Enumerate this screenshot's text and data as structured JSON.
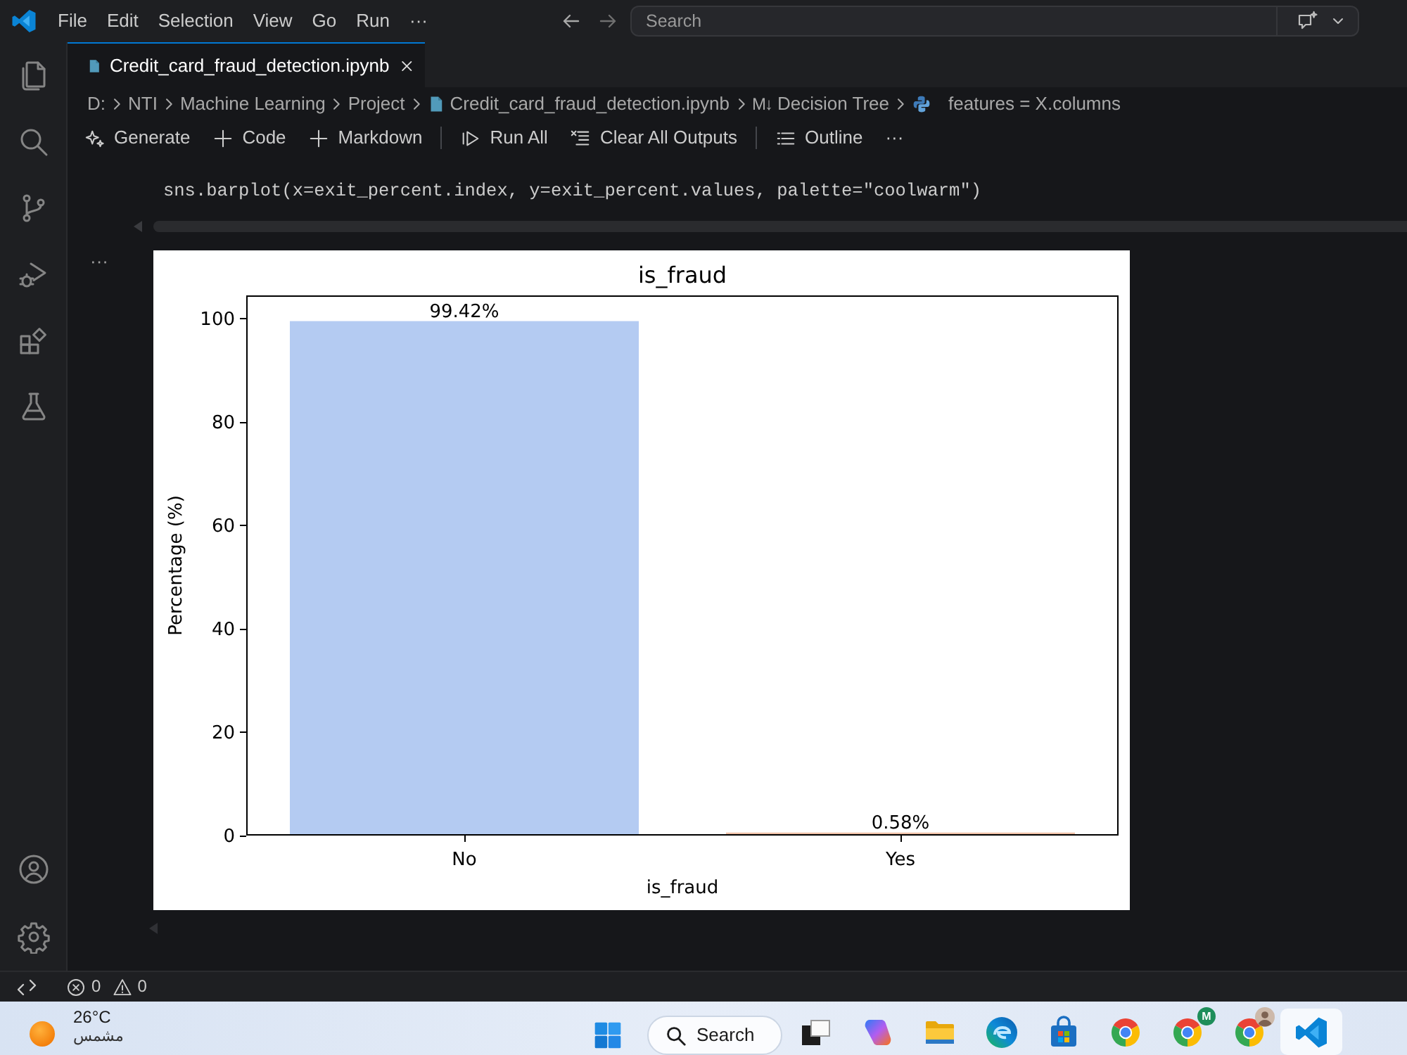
{
  "title_bar": {
    "menu": [
      "File",
      "Edit",
      "Selection",
      "View",
      "Go",
      "Run"
    ],
    "more": "···",
    "search": {
      "placeholder": "Search"
    }
  },
  "tabs": [
    {
      "label": "Credit_card_fraud_detection.ipynb",
      "selected": true
    }
  ],
  "breadcrumb": [
    {
      "kind": "folder",
      "label": "D:"
    },
    {
      "kind": "folder",
      "label": "NTI"
    },
    {
      "kind": "folder",
      "label": "Machine Learning"
    },
    {
      "kind": "folder",
      "label": "Project"
    },
    {
      "kind": "notebook",
      "label": "Credit_card_fraud_detection.ipynb"
    },
    {
      "kind": "markdown",
      "icon": "M↓",
      "label": "Decision Tree"
    },
    {
      "kind": "python",
      "label": "features = X.columns"
    }
  ],
  "toolbar": {
    "groups": [
      [
        {
          "kind": "generate",
          "label": "Generate"
        },
        {
          "kind": "add",
          "label": "Code"
        },
        {
          "kind": "add",
          "label": "Markdown"
        }
      ],
      [
        {
          "kind": "run",
          "label": "Run All"
        },
        {
          "kind": "clear",
          "label": "Clear All Outputs"
        }
      ],
      [
        {
          "kind": "outline",
          "label": "Outline"
        }
      ]
    ],
    "more": "···"
  },
  "cell": {
    "code": "sns.barplot(x=exit_percent.index, y=exit_percent.values, palette=\"coolwarm\")",
    "output_menu": "···",
    "chart_data": {
      "type": "bar",
      "title": "is_fraud",
      "xlabel": "is_fraud",
      "ylabel": "Percentage (%)",
      "categories": [
        "No",
        "Yes"
      ],
      "values": [
        99.42,
        0.58
      ],
      "colors": [
        "#b4cbf2",
        "#eebfa5"
      ],
      "ylim": [
        0,
        104.39
      ],
      "yticks": [
        0,
        20,
        40,
        60,
        80,
        100
      ],
      "value_labels": [
        "99.42%",
        "0.58%"
      ]
    }
  },
  "status_bar": {
    "errors": "0",
    "warnings": "0"
  },
  "taskbar": {
    "weather": {
      "temperature": "26°C",
      "condition": "مشمس"
    },
    "search": "Search",
    "apps": [
      {
        "kind": "taskview",
        "selected": false
      },
      {
        "kind": "copilot",
        "selected": false
      },
      {
        "kind": "explorer",
        "selected": false
      },
      {
        "kind": "edge",
        "selected": false
      },
      {
        "kind": "store",
        "selected": false
      },
      {
        "kind": "chrome",
        "selected": false
      },
      {
        "kind": "chrome",
        "badge": "M",
        "selected": false
      },
      {
        "kind": "chrome",
        "avatar": true,
        "selected": false
      },
      {
        "kind": "vscode",
        "selected": true
      }
    ]
  }
}
